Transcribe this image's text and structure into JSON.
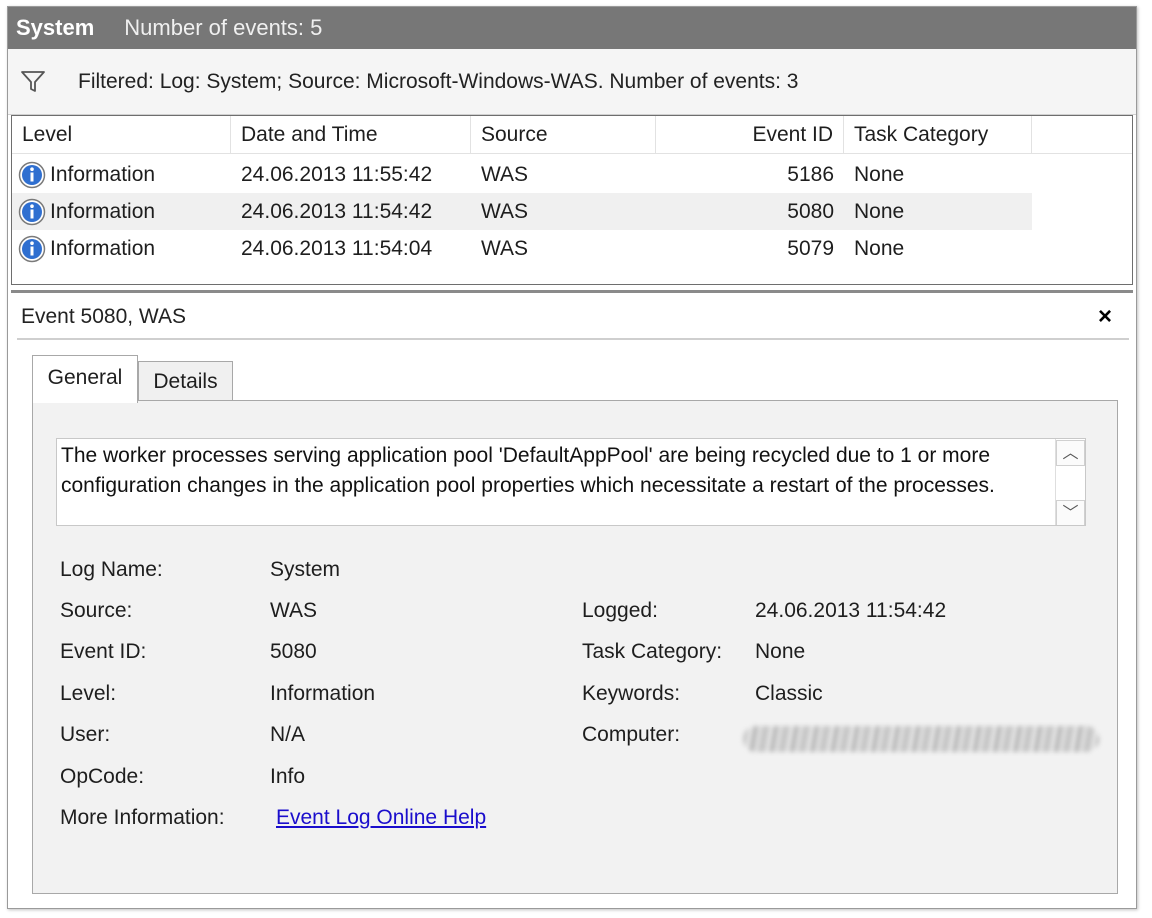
{
  "titlebar": {
    "log": "System",
    "count": "Number of events: 5"
  },
  "filter": {
    "text": "Filtered: Log: System; Source: Microsoft-Windows-WAS. Number of events: 3",
    "icon": "filter-icon"
  },
  "columns": {
    "level": "Level",
    "date": "Date and Time",
    "source": "Source",
    "event_id": "Event ID",
    "task_category": "Task Category"
  },
  "events": [
    {
      "level": "Information",
      "date": "24.06.2013 11:55:42",
      "source": "WAS",
      "event_id": "5186",
      "task_category": "None"
    },
    {
      "level": "Information",
      "date": "24.06.2013 11:54:42",
      "source": "WAS",
      "event_id": "5080",
      "task_category": "None"
    },
    {
      "level": "Information",
      "date": "24.06.2013 11:54:04",
      "source": "WAS",
      "event_id": "5079",
      "task_category": "None"
    }
  ],
  "detail": {
    "title": "Event 5080, WAS",
    "close_label": "×",
    "tabs": {
      "general": "General",
      "details": "Details"
    },
    "description": "The worker processes serving application pool 'DefaultAppPool' are being recycled due to 1 or more configuration changes in the application pool properties which necessitate a restart of the processes.",
    "labels": {
      "log_name": "Log Name:",
      "source": "Source:",
      "event_id": "Event ID:",
      "level": "Level:",
      "user": "User:",
      "opcode": "OpCode:",
      "more_info": "More Information:",
      "logged": "Logged:",
      "task_category": "Task Category:",
      "keywords": "Keywords:",
      "computer": "Computer:"
    },
    "values": {
      "log_name": "System",
      "source": "WAS",
      "event_id": "5080",
      "level": "Information",
      "user": "N/A",
      "opcode": "Info",
      "more_info_link": "Event Log Online Help",
      "logged": "24.06.2013 11:54:42",
      "task_category": "None",
      "keywords": "Classic"
    }
  },
  "colors": {
    "titlebar_bg": "#777777",
    "link": "#1a0dcc",
    "info_icon": "#2f6fd0"
  }
}
